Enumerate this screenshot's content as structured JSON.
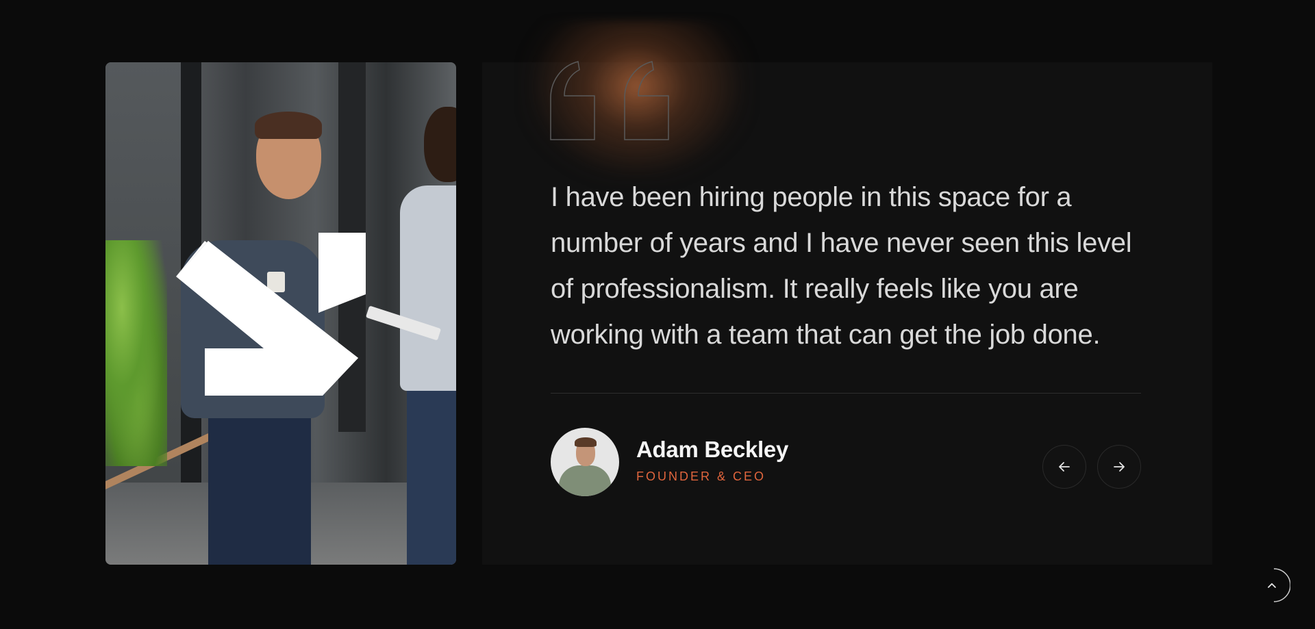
{
  "testimonial": {
    "quote": "I have been hiring people in this space for a number of years and I have never seen this level of professionalism. It really feels like you are working with a team that can get the job done.",
    "author_name": "Adam Beckley",
    "author_role": "FOUNDER & CEO"
  },
  "icons": {
    "quote": "quote-mark-icon",
    "prev": "arrow-left-icon",
    "next": "arrow-right-icon",
    "scroll_top": "chevron-up-icon",
    "logo": "brand-logo-mark"
  },
  "colors": {
    "background": "#0b0b0b",
    "panel": "#111111",
    "accent": "#e0653d",
    "text": "#d9d9d9"
  }
}
